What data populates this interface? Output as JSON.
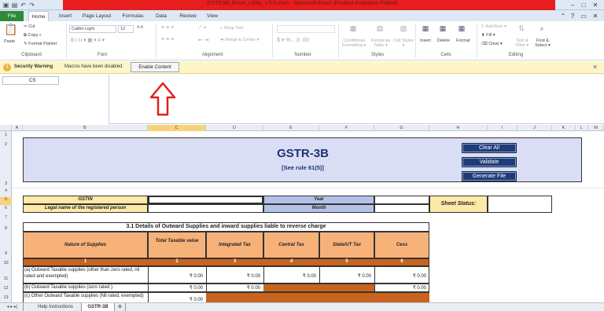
{
  "title_bar": {
    "title": "GSTR3B_Excel_Utility_V3.0.xlsm - Microsoft Excel (Product Activation Failed)",
    "min": "–",
    "max": "□",
    "close": "✕"
  },
  "ribbon_tabs": [
    "File",
    "Home",
    "Insert",
    "Page Layout",
    "Formulas",
    "Data",
    "Review",
    "View"
  ],
  "ribbon": {
    "paste": "Paste",
    "cut": "Cut",
    "copy": "Copy ▾",
    "format_painter": "Format Painter",
    "clipboard": "Clipboard",
    "font_name": "Calibri Light",
    "font_size": "12",
    "font": "Font",
    "wrap_text": "Wrap Text",
    "merge_center": "Merge & Center ▾",
    "alignment": "Alignment",
    "number": "Number",
    "conditional_formatting": "Conditional Formatting ▾",
    "format_as_table": "Format as Table ▾",
    "cell_styles": "Cell Styles ▾",
    "styles": "Styles",
    "insert": "Insert",
    "delete": "Delete",
    "format": "Format",
    "cells": "Cells",
    "autosum": "AutoSum ▾",
    "fill": "Fill ▾",
    "clear": "Clear ▾",
    "sort_filter": "Sort & Filter ▾",
    "find_select": "Find & Select ▾",
    "editing": "Editing"
  },
  "security_bar": {
    "title": "Security Warning",
    "message": "Macros have been disabled.",
    "button": "Enable Content"
  },
  "formula_bar": {
    "name_box": "C5",
    "fx": ""
  },
  "columns": [
    "A",
    "B",
    "C",
    "D",
    "E",
    "F",
    "G",
    "H",
    "I",
    "J",
    "K",
    "L",
    "M"
  ],
  "rows": [
    "1",
    "2",
    "3",
    "4",
    "5",
    "6",
    "7",
    "8",
    "9",
    "10",
    "11",
    "12",
    "13"
  ],
  "sheet": {
    "title": "GSTR-3B",
    "subtitle": "[See rule 61(5)]",
    "buttons": {
      "clear_all": "Clear All",
      "validate": "Validate",
      "generate_file": "Generate File"
    },
    "gstin_label": "GSTIN",
    "legal_name_label": "Legal name of the registered person",
    "year_label": "Year",
    "month_label": "Month",
    "sheet_status_label": "Sheet Status:",
    "section_title": "3.1 Details of Outward Supplies and inward supplies liable to reverse charge",
    "table_headers": [
      "Nature of Supplies",
      "Total Taxable value",
      "Integrated Tax",
      "Central Tax",
      "State/UT Tax",
      "Cess"
    ],
    "col_numbers": [
      "1",
      "2",
      "3",
      "4",
      "5",
      "6"
    ],
    "row_a": "(a) Outward Taxable supplies (other than zero rated, nil rated and exempted)",
    "row_b": "(b) Outward Taxable supplies (zero rated )",
    "row_c": "(c) Other Outward Taxable supplies (Nil rated, exempted)",
    "amount": "₹ 0.00"
  },
  "sheet_tabs": [
    "Help Instructions",
    "GSTR-3B"
  ]
}
